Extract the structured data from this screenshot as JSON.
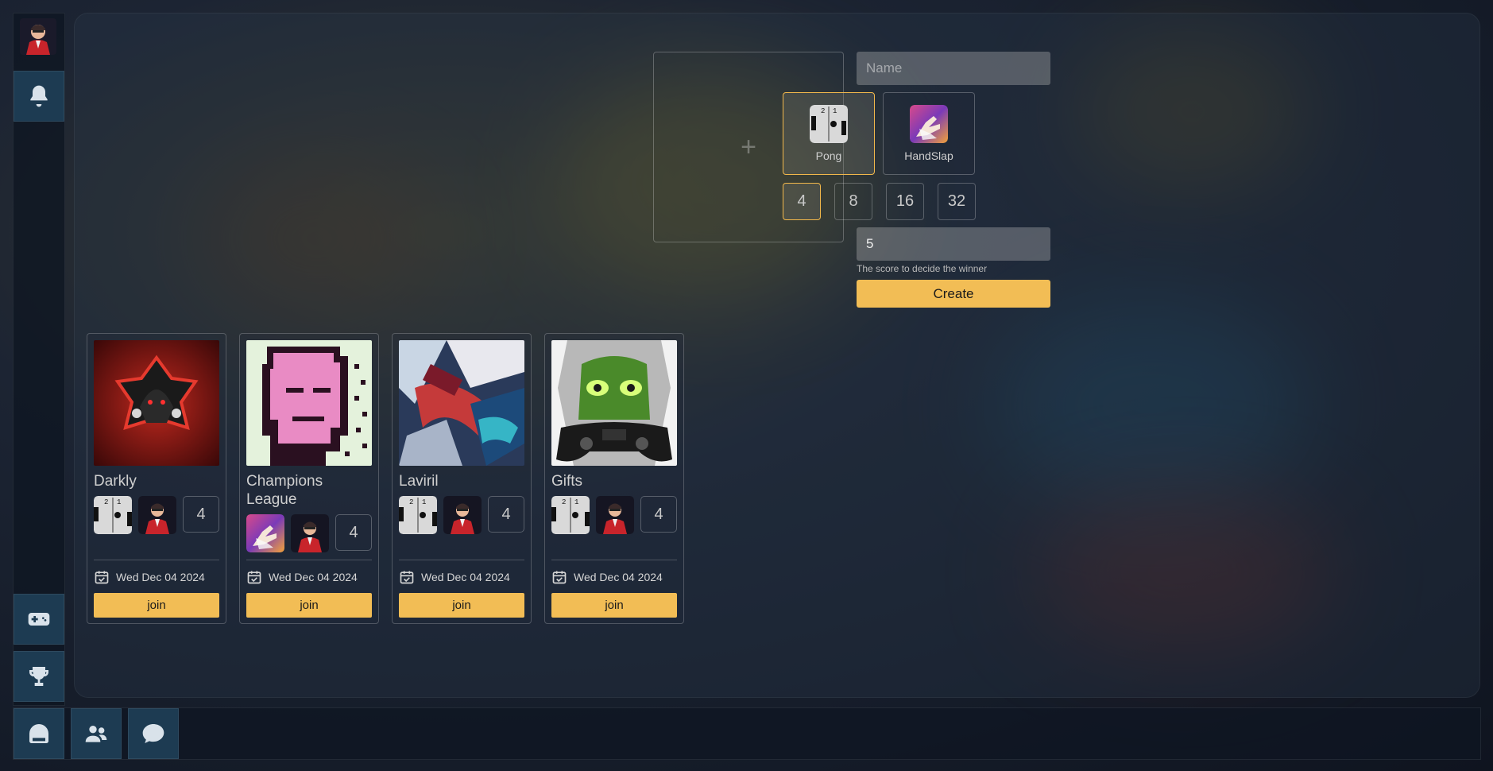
{
  "form": {
    "name_placeholder": "Name",
    "games": [
      {
        "label": "Pong",
        "icon": "pong-icon",
        "selected": true
      },
      {
        "label": "HandSlap",
        "icon": "handslap-icon",
        "selected": false
      }
    ],
    "player_counts": [
      "4",
      "8",
      "16",
      "32"
    ],
    "selected_count": "4",
    "score_value": "5",
    "score_hint": "The score to decide the winner",
    "create_label": "Create"
  },
  "tournaments": [
    {
      "title": "Darkly",
      "game_icon": "pong-icon",
      "players": "4",
      "date": "Wed Dec 04 2024",
      "join_label": "join",
      "thumbnail": "hooded-figure-logo"
    },
    {
      "title": "Champions League",
      "game_icon": "handslap-icon",
      "players": "4",
      "date": "Wed Dec 04 2024",
      "join_label": "join",
      "thumbnail": "pixel-face-pink"
    },
    {
      "title": "Laviril",
      "game_icon": "pong-icon",
      "players": "4",
      "date": "Wed Dec 04 2024",
      "join_label": "join",
      "thumbnail": "abstract-art"
    },
    {
      "title": "Gifts",
      "game_icon": "pong-icon",
      "players": "4",
      "date": "Wed Dec 04 2024",
      "join_label": "join",
      "thumbnail": "green-face-controller"
    }
  ],
  "colors": {
    "accent": "#f2bd55",
    "nav_button": "#1d3b52",
    "selected_border": "#f2b84b"
  },
  "nav": {
    "top": [
      "user-avatar",
      "bell-icon"
    ],
    "side_bottom": [
      "gamepad-icon",
      "trophy-icon"
    ],
    "bottom": [
      "home-icon",
      "friends-icon",
      "chat-icon"
    ]
  }
}
